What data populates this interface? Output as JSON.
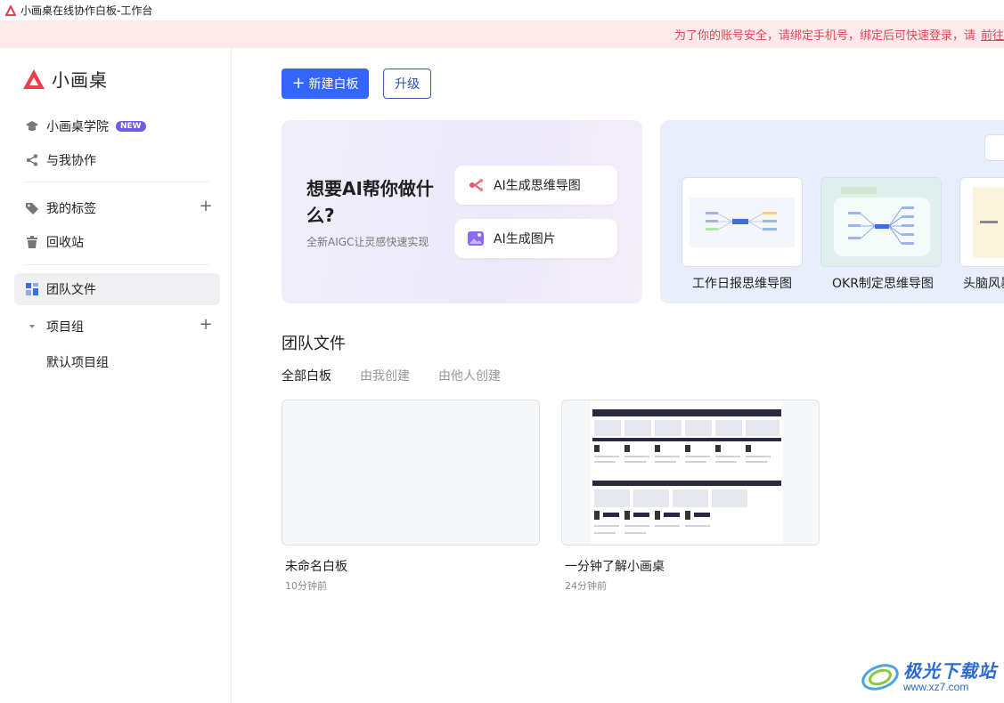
{
  "window": {
    "title": "小画桌在线协作白板-工作台"
  },
  "notice": {
    "text": "为了你的账号安全，请绑定手机号，绑定后可快速登录，请",
    "link": "前往"
  },
  "brand": {
    "name": "小画桌"
  },
  "sidebar": {
    "academy": {
      "label": "小画桌学院",
      "badge": "NEW"
    },
    "collab": {
      "label": "与我协作"
    },
    "tags": {
      "label": "我的标签"
    },
    "trash": {
      "label": "回收站"
    },
    "team_files": {
      "label": "团队文件"
    },
    "project_group": {
      "label": "项目组"
    },
    "default_project": {
      "label": "默认项目组"
    }
  },
  "toolbar": {
    "new_board": "新建白板",
    "upgrade": "升级"
  },
  "ai_card": {
    "title": "想要AI帮你做什么?",
    "subtitle": "全新AIGC让灵感快速实现",
    "mindmap": "AI生成思维导图",
    "image": "AI生成图片"
  },
  "templates": [
    {
      "label": "工作日报思维导图"
    },
    {
      "label": "OKR制定思维导图"
    },
    {
      "label": "头脑风暴"
    }
  ],
  "section": {
    "title": "团队文件",
    "tabs": [
      "全部白板",
      "由我创建",
      "由他人创建"
    ]
  },
  "files": [
    {
      "name": "未命名白板",
      "time": "10分钟前"
    },
    {
      "name": "一分钟了解小画桌",
      "time": "24分钟前"
    }
  ],
  "watermark": {
    "title": "极光下载站",
    "url": "www.xz7.com"
  },
  "colors": {
    "primary": "#3366ff",
    "brand_red": "#e8404f",
    "badge": "#6b5cf0",
    "notice_bg": "#fde8ea"
  }
}
